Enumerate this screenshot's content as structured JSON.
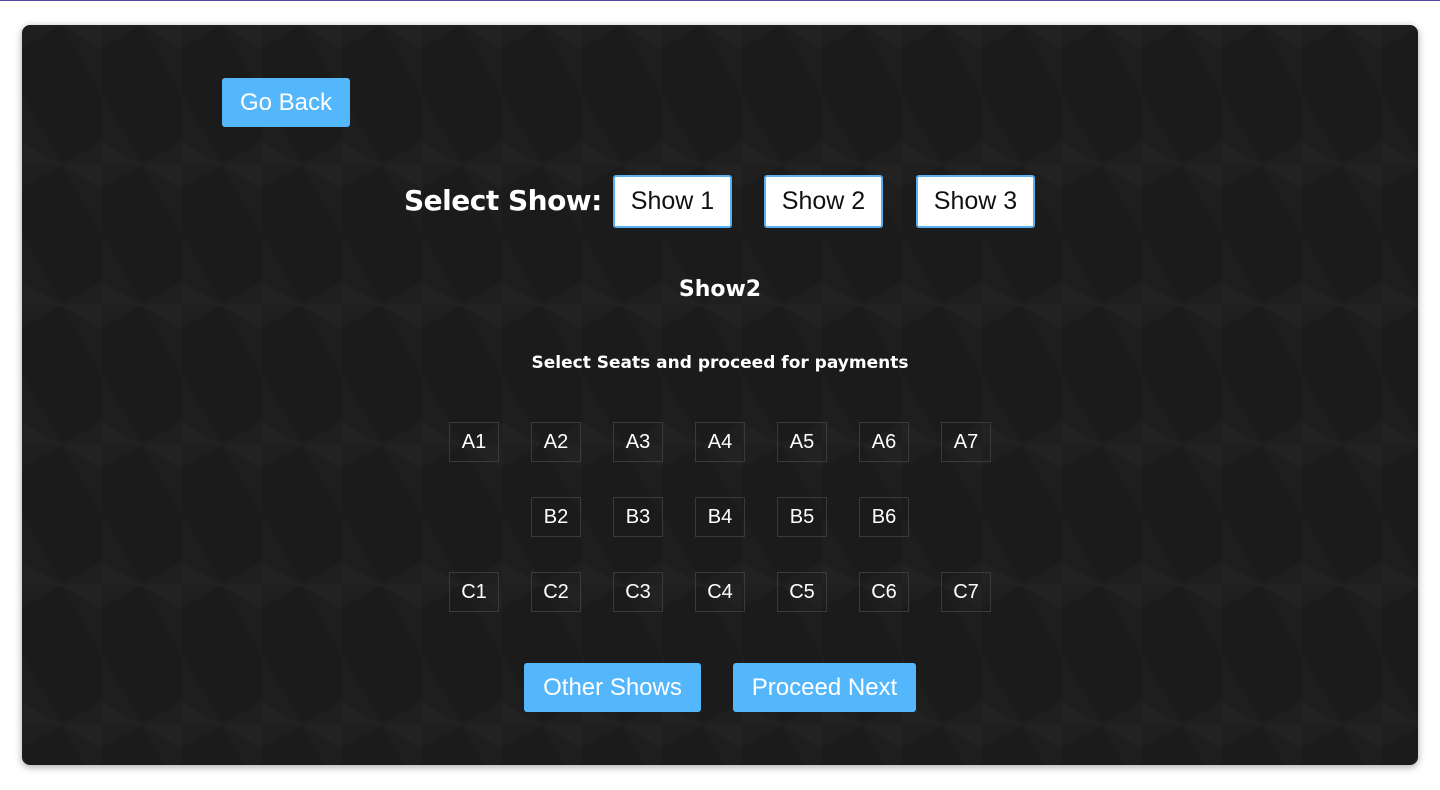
{
  "nav": {
    "go_back_label": "Go Back"
  },
  "show_selector": {
    "label": "Select Show:",
    "options": [
      "Show 1",
      "Show 2",
      "Show 3"
    ]
  },
  "current_show": "Show2",
  "instructions": "Select Seats and proceed for payments",
  "seats": {
    "row_a": [
      "A1",
      "A2",
      "A3",
      "A4",
      "A5",
      "A6",
      "A7"
    ],
    "row_b": [
      "B2",
      "B3",
      "B4",
      "B5",
      "B6"
    ],
    "row_c": [
      "C1",
      "C2",
      "C3",
      "C4",
      "C5",
      "C6",
      "C7"
    ]
  },
  "actions": {
    "other_shows_label": "Other Shows",
    "proceed_next_label": "Proceed Next"
  },
  "colors": {
    "accent": "#54b6fb",
    "panel_bg": "#1b1b1b",
    "show_button_border": "#5aaff0"
  }
}
